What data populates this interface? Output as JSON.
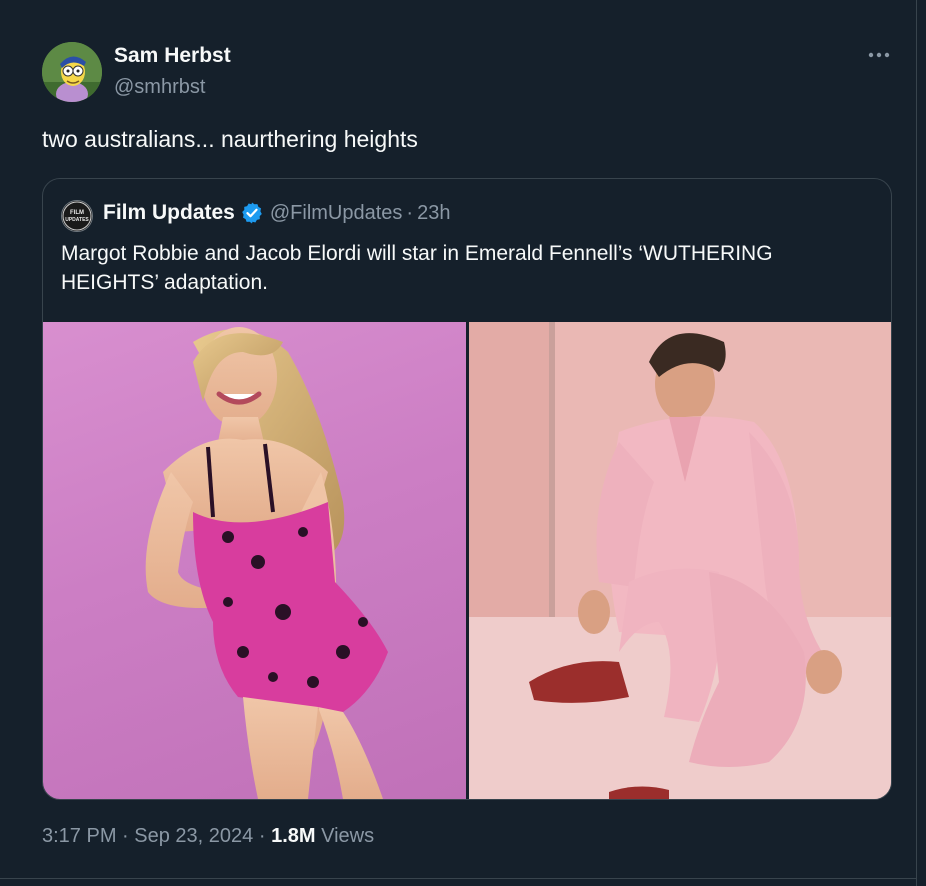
{
  "colors": {
    "background": "#15202b",
    "text_primary": "#f7f9f9",
    "text_secondary": "#8b98a5",
    "border": "#38444d",
    "verified_blue": "#1d9bf0"
  },
  "tweet": {
    "author_name": "Sam Herbst",
    "author_handle": "@smhrbst",
    "text": "two australians... naurthering heights",
    "more_icon": "more-horizontal-icon"
  },
  "quoted_tweet": {
    "author_name": "Film Updates",
    "author_handle": "@FilmUpdates",
    "separator": "·",
    "relative_time": "23h",
    "text": "Margot Robbie and Jacob Elordi will star in Emerald Fennell’s ‘WUTHERING HEIGHTS’ adaptation.",
    "verified_icon": "verified-badge-icon",
    "media": [
      {
        "kind": "photo",
        "subject": "woman in pink floral dress on pink backdrop"
      },
      {
        "kind": "photo",
        "subject": "man in pink suit seated on floor"
      }
    ]
  },
  "meta": {
    "time": "3:17 PM",
    "sep1": "·",
    "date": "Sep 23, 2024",
    "sep2": "·",
    "views_count": "1.8M",
    "views_label": "Views"
  }
}
